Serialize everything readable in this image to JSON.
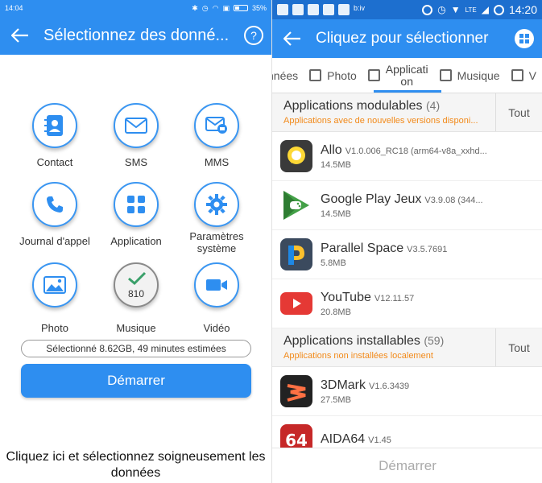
{
  "left": {
    "status": {
      "time": "14:04",
      "battery": "35%"
    },
    "appbar": {
      "title": "Sélectionnez des donné...",
      "help": "?"
    },
    "items": [
      {
        "label": "Contact",
        "icon": "contact-book-icon"
      },
      {
        "label": "SMS",
        "icon": "envelope-icon"
      },
      {
        "label": "MMS",
        "icon": "mms-icon"
      },
      {
        "label": "Journal d'appel",
        "icon": "phone-icon"
      },
      {
        "label": "Application",
        "icon": "app-grid-icon"
      },
      {
        "label": "Paramètres système",
        "icon": "gear-icon"
      },
      {
        "label": "Photo",
        "icon": "image-icon"
      },
      {
        "label": "Musique",
        "icon": "checkmark-icon",
        "count": "810",
        "selected": true
      },
      {
        "label": "Vidéo",
        "icon": "video-camera-icon"
      }
    ],
    "summary": "Sélectionné 8.62GB, 49 minutes estimées",
    "start_label": "Démarrer",
    "caption": "Cliquez ici et sélectionnez soigneusement les données",
    "accent": "#2e8ef0"
  },
  "right": {
    "status": {
      "time": "14:20",
      "network": "LTE",
      "carrier": "b:iv"
    },
    "appbar": {
      "title": "Cliquez pour sélectionner"
    },
    "tabs": [
      {
        "label": "nnées"
      },
      {
        "label": "Photo"
      },
      {
        "label": "Application",
        "line1": "Applicati",
        "line2": "on"
      },
      {
        "label": "Musique"
      },
      {
        "label": "V"
      }
    ],
    "sections": [
      {
        "title": "Applications modulables",
        "count": "(4)",
        "subtitle": "Applications avec de nouvelles versions disponi...",
        "all_label": "Tout",
        "apps": [
          {
            "name": "Allo",
            "version": "V1.0.006_RC18 (arm64-v8a_xxhd...",
            "size": "14.5MB",
            "icon": "allo-icon"
          },
          {
            "name": "Google Play Jeux",
            "version": "V3.9.08 (344...",
            "size": "14.5MB",
            "icon": "play-games-icon"
          },
          {
            "name": "Parallel Space",
            "version": "V3.5.7691",
            "size": "5.8MB",
            "icon": "parallel-space-icon"
          },
          {
            "name": "YouTube",
            "version": "V12.11.57",
            "size": "20.8MB",
            "icon": "youtube-icon"
          }
        ]
      },
      {
        "title": "Applications installables",
        "count": "(59)",
        "subtitle": "Applications non installées localement",
        "all_label": "Tout",
        "apps": [
          {
            "name": "3DMark",
            "version": "V1.6.3439",
            "size": "27.5MB",
            "icon": "3dmark-icon"
          },
          {
            "name": "AIDA64",
            "version": "V1.45",
            "size": "",
            "icon": "aida64-icon"
          }
        ]
      }
    ],
    "start_label": "Démarrer",
    "accent": "#2e8ef0",
    "warning": "#f28a1a"
  }
}
